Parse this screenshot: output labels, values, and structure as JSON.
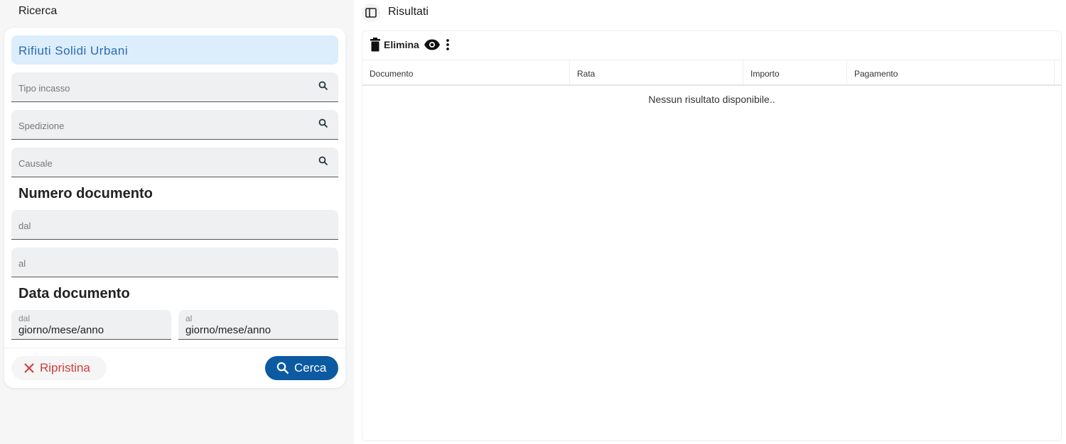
{
  "left": {
    "title": "Ricerca",
    "category": "Rifiuti Solidi Urbani",
    "fields": [
      "Tipo incasso",
      "Spedizione",
      "Causale"
    ],
    "numero_heading": "Numero documento",
    "numero_from": "dal",
    "numero_to": "al",
    "data_heading": "Data documento",
    "date_from": {
      "label": "dal",
      "value": "giorno/mese/anno"
    },
    "date_to": {
      "label": "al",
      "value": "giorno/mese/anno"
    },
    "reset_label": "Ripristina",
    "search_label": "Cerca"
  },
  "right": {
    "title": "Risultati",
    "delete_label": "Elimina",
    "columns": [
      "Documento",
      "Rata",
      "Importo",
      "Pagamento"
    ],
    "empty_message": "Nessun risultato disponibile.."
  }
}
